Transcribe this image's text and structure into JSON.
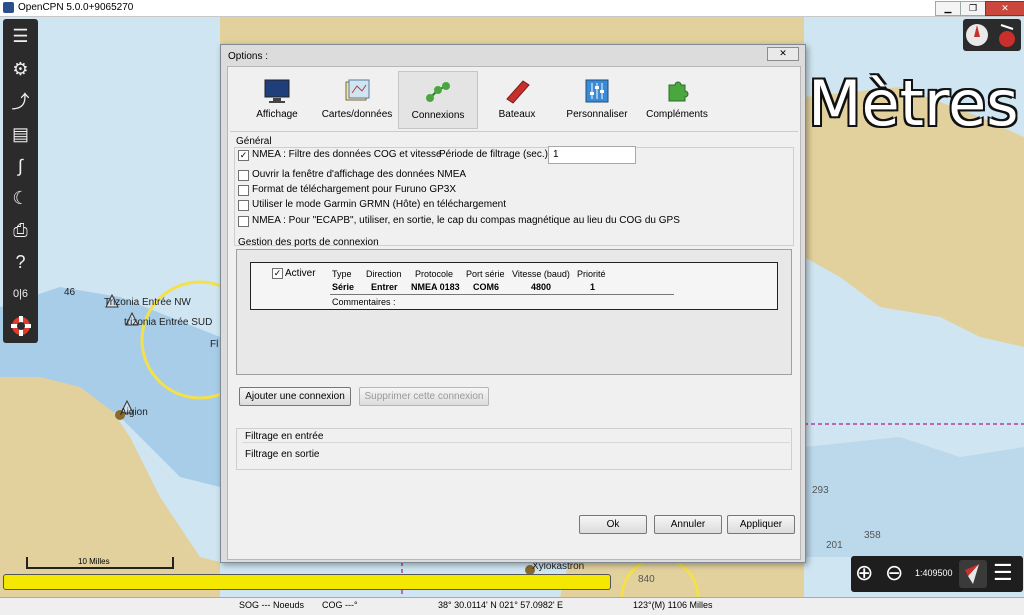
{
  "window": {
    "title": "OpenCPN 5.0.0+9065270",
    "minimize": "▁",
    "maximize": "❐",
    "close": "✕"
  },
  "map": {
    "unit_watermark": "Mètres",
    "labels": [
      "46",
      "Trizonia Entrée NW",
      "trizonia Entrée SUD",
      "Fl",
      "Aigion",
      "293",
      "358",
      "201",
      "840",
      "Xylokastron"
    ],
    "scale_label": "10 Milles",
    "zoom_scale": "1:409500",
    "progress_color": "#f5e800"
  },
  "toolbar": {
    "icons": [
      "menu-icon",
      "gear-icon",
      "route-icon",
      "document-icon",
      "track-icon",
      "moon-icon",
      "print-icon",
      "help-icon",
      "ais-icon",
      "lifebuoy-icon"
    ],
    "ais_label": "0|6"
  },
  "statusbar": {
    "sog": "SOG --- Noeuds",
    "cog": "COG ---°",
    "position": "38° 30.0114' N    021° 57.0982' E",
    "bearing": "123°(M)  1106 Milles"
  },
  "dialog": {
    "title": "Options :",
    "close": "✕",
    "tabs": [
      {
        "label": "Affichage",
        "icon": "monitor-icon"
      },
      {
        "label": "Cartes/données",
        "icon": "charts-icon"
      },
      {
        "label": "Connexions",
        "icon": "connections-icon"
      },
      {
        "label": "Bateaux",
        "icon": "ship-icon"
      },
      {
        "label": "Personnaliser",
        "icon": "sliders-icon"
      },
      {
        "label": "Compléments",
        "icon": "puzzle-icon"
      }
    ],
    "active_tab": "Connexions",
    "general": {
      "heading": "Général",
      "nmea_filter_label": "NMEA : Filtre des données COG et vitesse",
      "nmea_filter_checked": true,
      "period_label": "Période de filtrage (sec.)",
      "period_value": "1",
      "options": [
        {
          "label": "Ouvrir la fenêtre d'affichage des données NMEA",
          "checked": false
        },
        {
          "label": "Format de téléchargement pour Furuno GP3X",
          "checked": false
        },
        {
          "label": "Utiliser le mode Garmin GRMN (Hôte) en téléchargement",
          "checked": false
        },
        {
          "label": "NMEA : Pour \"ECAPB\", utiliser, en sortie, le cap du compas magnétique  au lieu du COG du GPS",
          "checked": false
        }
      ]
    },
    "ports": {
      "heading": "Gestion des ports de connexion",
      "enable_label": "Activer",
      "enabled": true,
      "columns": [
        "Type",
        "Direction",
        "Protocole",
        "Port série",
        "Vitesse (baud)",
        "Priorité"
      ],
      "row": [
        "Série",
        "Entrer",
        "NMEA 0183",
        "COM6",
        "4800",
        "1"
      ],
      "comments_label": "Commentaires :"
    },
    "add_button": "Ajouter une connexion",
    "remove_button": "Supprimer cette connexion",
    "input_filter": "Filtrage en entrée",
    "output_filter": "Filtrage en sortie",
    "ok_button": "Ok",
    "cancel_button": "Annuler",
    "apply_button": "Appliquer"
  }
}
